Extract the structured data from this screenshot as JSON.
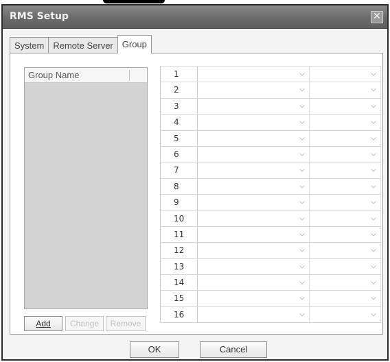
{
  "window": {
    "title": "RMS Setup"
  },
  "tabs": [
    {
      "label": "System"
    },
    {
      "label": "Remote Server"
    },
    {
      "label": "Group"
    }
  ],
  "group_list": {
    "column_header": "Group Name"
  },
  "group_buttons": {
    "add": "Add",
    "change": "Change",
    "remove": "Remove"
  },
  "rows": [
    {
      "number": "1"
    },
    {
      "number": "2"
    },
    {
      "number": "3"
    },
    {
      "number": "4"
    },
    {
      "number": "5"
    },
    {
      "number": "6"
    },
    {
      "number": "7"
    },
    {
      "number": "8"
    },
    {
      "number": "9"
    },
    {
      "number": "10"
    },
    {
      "number": "11"
    },
    {
      "number": "12"
    },
    {
      "number": "13"
    },
    {
      "number": "14"
    },
    {
      "number": "15"
    },
    {
      "number": "16"
    }
  ],
  "footer": {
    "ok": "OK",
    "cancel": "Cancel"
  }
}
